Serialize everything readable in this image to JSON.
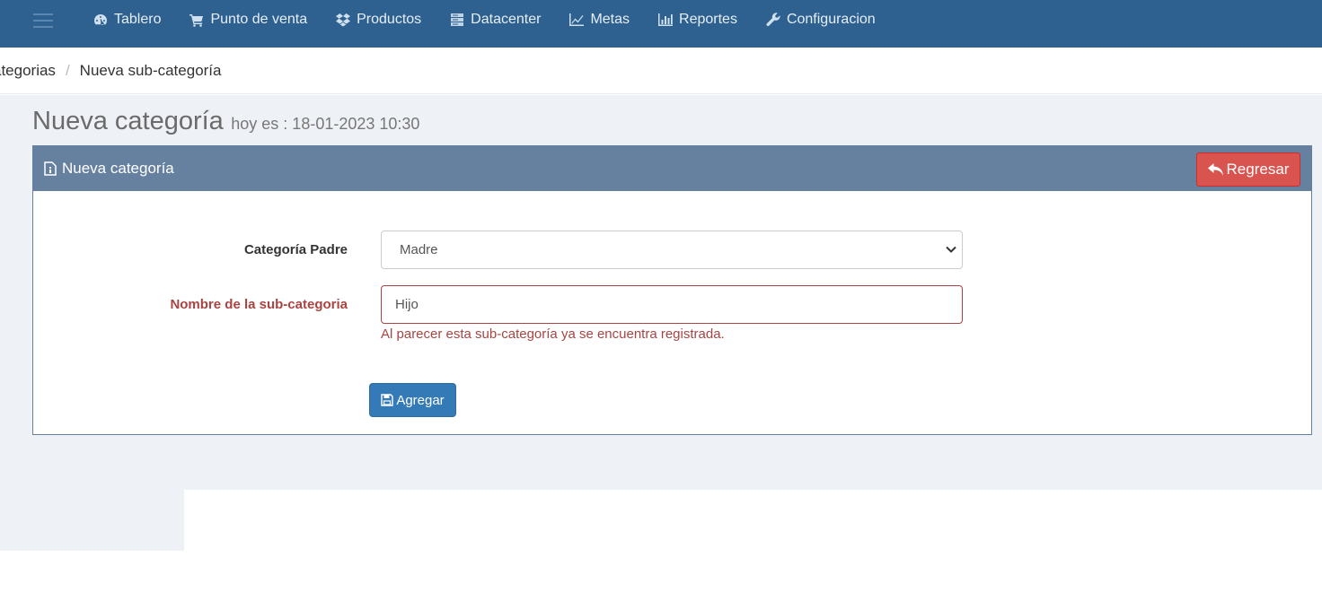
{
  "nav": {
    "items": [
      {
        "label": "Tablero",
        "icon": "dashboard-icon"
      },
      {
        "label": "Punto de venta",
        "icon": "cart-icon"
      },
      {
        "label": "Productos",
        "icon": "dropbox-icon"
      },
      {
        "label": "Datacenter",
        "icon": "server-icon"
      },
      {
        "label": "Metas",
        "icon": "line-chart-icon"
      },
      {
        "label": "Reportes",
        "icon": "bar-chart-icon"
      },
      {
        "label": "Configuracion",
        "icon": "wrench-icon"
      }
    ]
  },
  "breadcrumb": {
    "items": [
      "ategorias",
      "Nueva sub-categoría"
    ],
    "separator": "/"
  },
  "page": {
    "title": "Nueva categoría",
    "subtitle": "hoy es : 18-01-2023 10:30"
  },
  "panel": {
    "title": "Nueva categoría",
    "back_label": "Regresar"
  },
  "form": {
    "parent_label": "Categoría Padre",
    "parent_value": "Madre",
    "name_label": "Nombre de la sub-categoria",
    "name_value": "Hijo",
    "error_text": "Al parecer esta sub-categoría ya se encuentra registrada.",
    "submit_label": "Agregar"
  },
  "colors": {
    "topbar": "#2e6190",
    "panel_header": "#66809f",
    "danger": "#d9534f",
    "primary": "#337ab7",
    "error": "#a94442"
  }
}
